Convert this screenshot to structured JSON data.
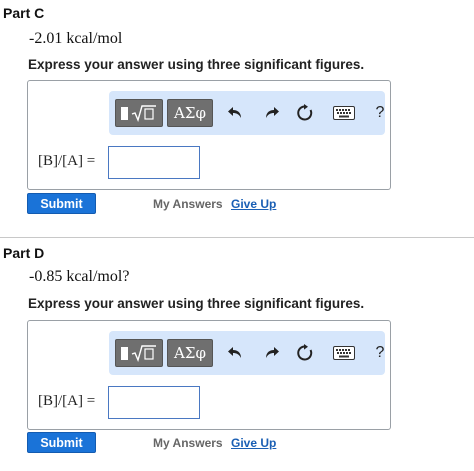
{
  "parts": [
    {
      "title": "Part C",
      "prompt": "-2.01 kcal/mol",
      "instruction": "Express your answer using three significant figures.",
      "toolbar": {
        "template_icon": "square-root-template-icon",
        "greek_label": "ΑΣφ",
        "undo_icon": "undo-icon",
        "redo_icon": "redo-icon",
        "reset_icon": "reset-icon",
        "keyboard_icon": "keyboard-icon",
        "help_label": "?"
      },
      "equation_label": "[B]/[A] =",
      "answer_value": "",
      "submit_label": "Submit",
      "my_answers_label": "My Answers",
      "give_up_label": "Give Up"
    },
    {
      "title": "Part D",
      "prompt": "-0.85 kcal/mol?",
      "instruction": "Express your answer using three significant figures.",
      "toolbar": {
        "template_icon": "square-root-template-icon",
        "greek_label": "ΑΣφ",
        "undo_icon": "undo-icon",
        "redo_icon": "redo-icon",
        "reset_icon": "reset-icon",
        "keyboard_icon": "keyboard-icon",
        "help_label": "?"
      },
      "equation_label": "[B]/[A] =",
      "answer_value": "",
      "submit_label": "Submit",
      "my_answers_label": "My Answers",
      "give_up_label": "Give Up"
    }
  ],
  "colors": {
    "toolbar_bg": "#d6e6fb",
    "submit_bg": "#1a73d8",
    "link": "#1a5fb4",
    "input_border": "#4a78c2"
  }
}
